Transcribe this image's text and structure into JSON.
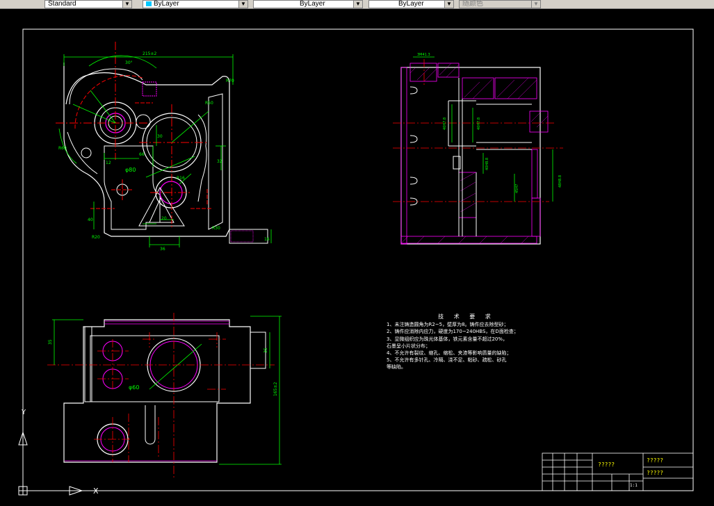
{
  "toolbar": {
    "textstyle": "Standard",
    "layer_color": "ByLayer",
    "linetype": "ByLayer",
    "lineweight": "ByLayer",
    "plotstyle": "随颜色"
  },
  "drawing": {
    "dims": {
      "top_width": "215±2",
      "angle30": "30°",
      "r60": "R60",
      "r70": "R70",
      "r50": "R50",
      "phi80": "φ80",
      "phi60": "φ60",
      "dim12": "12",
      "dim66": "66",
      "dim32": "32",
      "dim20": "20",
      "dim30": "30",
      "dim40": "40",
      "dim36": "36",
      "dim16": "16",
      "r16": "R16",
      "r30": "R30",
      "r20": "R20",
      "dim35": "35",
      "dim165": "165±2",
      "side_top": "3M41.3",
      "side_phi1": "40H7.8",
      "side_phi2": "40H7.8",
      "side_phi3": "40H8.8",
      "side_45": "45H7",
      "side_48": "48H8.8"
    }
  },
  "notes": {
    "title": "技 术 要 求",
    "lines": [
      "1、未注铸造圆角为R2~5，壁厚为8。铸件应去除型砂；",
      "2、铸件应消除内应力，硬度为170~240HBS，在D面检查；",
      "3、显微组织应为珠光体基体，铁元素含量不超过20%，",
      "   石墨呈小片状分布；",
      "4、不允许有裂纹、缩孔、缩松、夹渣等影响质量的缺陷；",
      "5、不允许有多针孔、冷隔、浇不足、粘砂、疏松、砂孔",
      "   等缺陷。"
    ]
  },
  "title_block": {
    "name": "?????",
    "material": "?????",
    "drawing_no": "?????",
    "scale": "1:1"
  },
  "ucs": {
    "x_label": "X",
    "y_label": "Y"
  }
}
